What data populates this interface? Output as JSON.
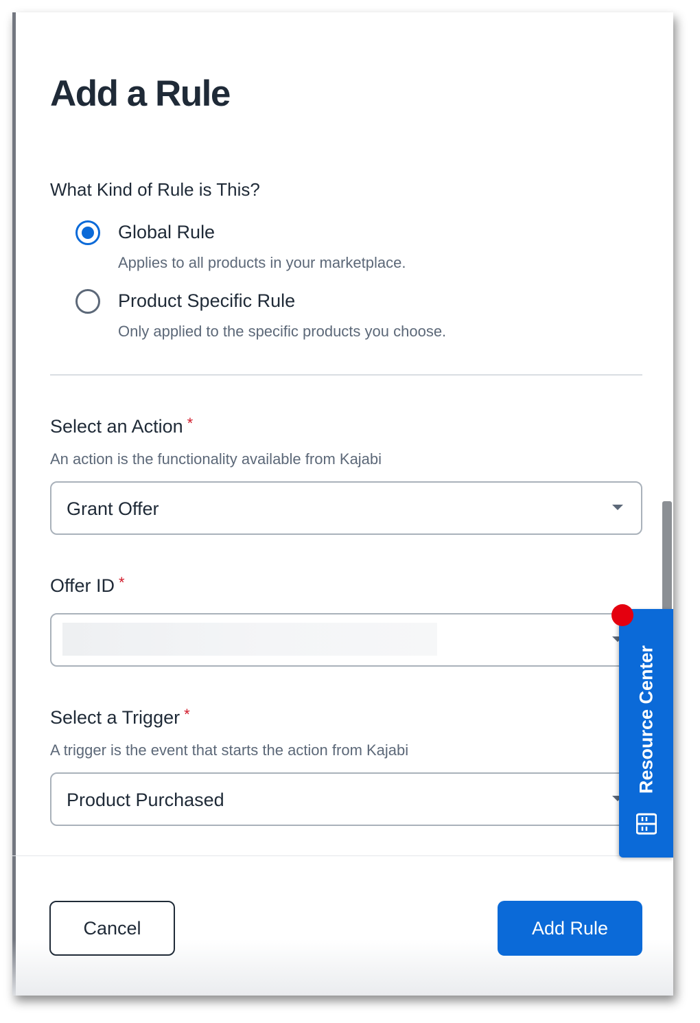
{
  "dialog": {
    "title": "Add a Rule"
  },
  "rule_type": {
    "question": "What Kind of Rule is This?",
    "options": [
      {
        "label": "Global Rule",
        "description": "Applies to all products in your marketplace.",
        "selected": true
      },
      {
        "label": "Product Specific Rule",
        "description": "Only applied to the specific products you choose.",
        "selected": false
      }
    ]
  },
  "action": {
    "label": "Select an Action",
    "required_mark": "*",
    "help": "An action is the functionality available from Kajabi",
    "value": "Grant Offer"
  },
  "offer": {
    "label": "Offer ID",
    "required_mark": "*",
    "value": ""
  },
  "trigger": {
    "label": "Select a Trigger",
    "required_mark": "*",
    "help": "A trigger is the event that starts the action from Kajabi",
    "value": "Product Purchased"
  },
  "footer": {
    "cancel_label": "Cancel",
    "submit_label": "Add Rule"
  },
  "resource_center": {
    "label": "Resource Center",
    "icon": "book-icon",
    "has_notification": true
  },
  "colors": {
    "primary": "#0b6ad8",
    "text": "#1f2a37",
    "muted": "#5c6878",
    "required": "#d11a2a",
    "notification": "#e4000f"
  }
}
